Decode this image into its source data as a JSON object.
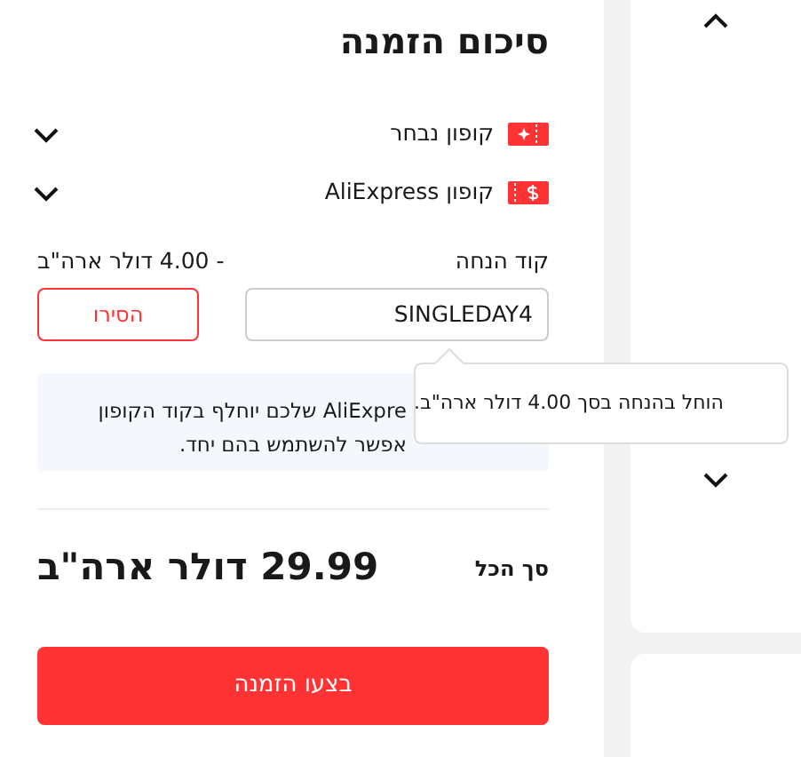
{
  "title": "סיכום הזמנה",
  "coupons": [
    {
      "label": "קופון נבחר",
      "kind": "store"
    },
    {
      "label": "קופון AliExpress",
      "kind": "platform"
    }
  ],
  "discount": {
    "label": "קוד הנחה",
    "amount": "- 4.00 דולר ארה\"ב",
    "code": "SINGLEDAY4",
    "remove_button": "הסירו"
  },
  "notice": {
    "lines": [
      "AliExpre שלכם יוחלף בקוד הקופון",
      "אפשר להשתמש בהם יחד."
    ]
  },
  "tooltip": "הוחל בהנחה בסך 4.00 דולר ארה\"ב.",
  "total": {
    "label": "סך הכל",
    "value": "29.99 דולר ארה\"ב"
  },
  "order_button": "בצעו הזמנה"
}
